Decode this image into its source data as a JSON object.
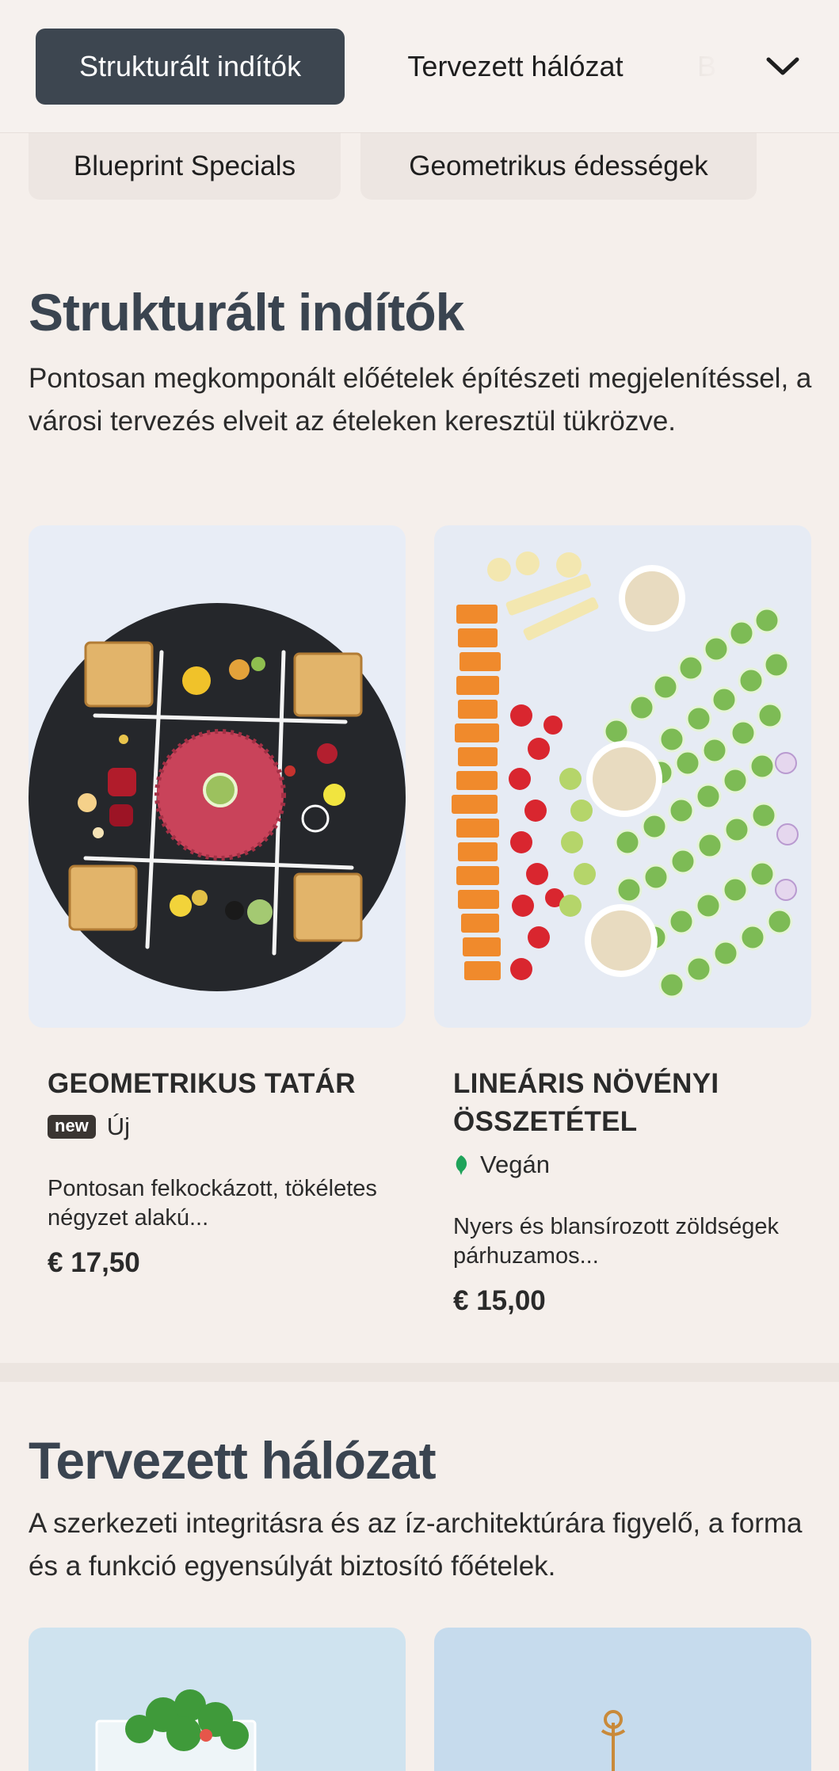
{
  "nav": {
    "tabs": [
      {
        "label": "Strukturált indítók",
        "active": true
      },
      {
        "label": "Tervezett hálózat",
        "active": false
      },
      {
        "label": "B",
        "active": false
      }
    ],
    "chips": [
      "Blueprint Specials",
      "Geometrikus édességek"
    ],
    "more_icon": "chevron-down-icon"
  },
  "sections": [
    {
      "title": "Strukturált indítók",
      "description": "Pontosan megkomponált előételek építészeti megjelenítéssel, a városi tervezés elveit az ételeken keresztül tükrözve.",
      "items": [
        {
          "name": "GEOMETRIKUS TATÁR",
          "badge": "new",
          "tag": "Új",
          "description": "Pontosan felkockázott, tökéletes négyzet alakú...",
          "price": "€ 17,50"
        },
        {
          "name": "LINEÁRIS NÖVÉNYI ÖSSZETÉTEL",
          "tag": "Vegán",
          "tag_icon": "leaf-icon",
          "description": "Nyers és blansírozott zöldségek párhuzamos...",
          "price": "€ 15,00"
        }
      ]
    },
    {
      "title": "Tervezett hálózat",
      "description": "A szerkezeti integritásra és az íz-architektúrára figyelő, a forma és a funkció egyensúlyát biztosító főételek."
    }
  ],
  "colors": {
    "page_bg": "#f5efeb",
    "active_tab": "#3d4650",
    "heading": "#3a4450",
    "vegan_leaf": "#1fa35a"
  }
}
